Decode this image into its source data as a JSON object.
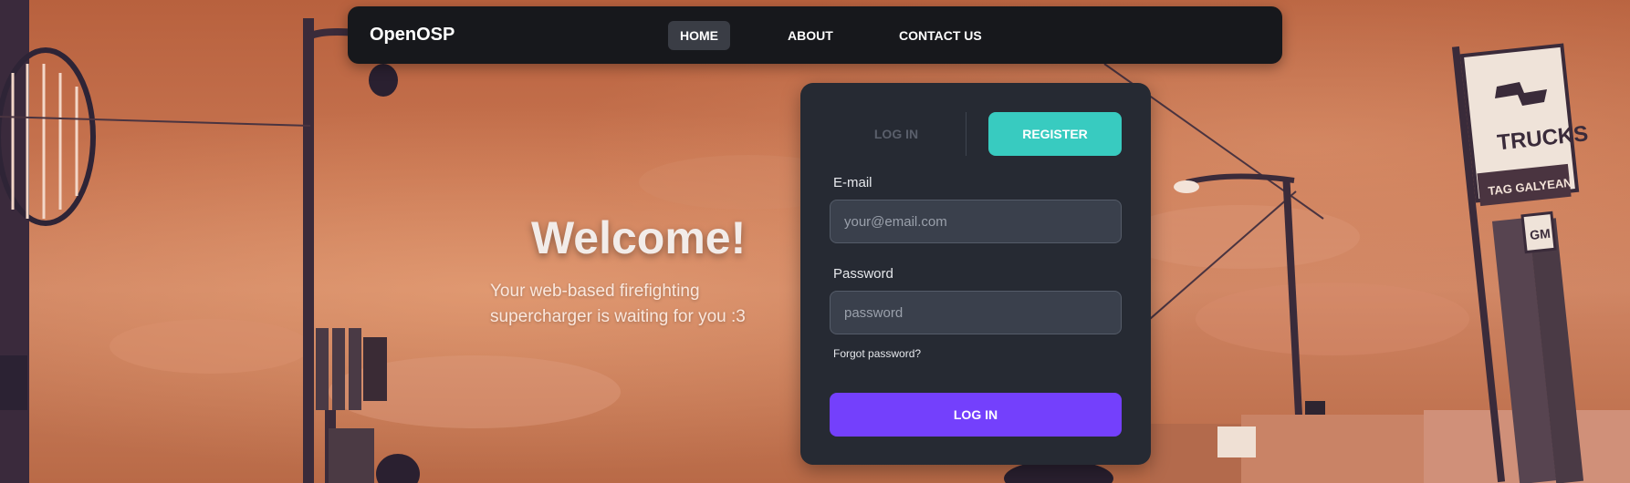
{
  "navbar": {
    "brand": "OpenOSP",
    "links": [
      {
        "label": "HOME",
        "active": true
      },
      {
        "label": "ABOUT",
        "active": false
      },
      {
        "label": "CONTACT US",
        "active": false
      }
    ]
  },
  "hero": {
    "title": "Welcome!",
    "subtitle": "Your web-based firefighting supercharger is waiting for you :3"
  },
  "auth": {
    "tabs": {
      "login_label": "LOG IN",
      "register_label": "REGISTER",
      "active": "register"
    },
    "email": {
      "label": "E-mail",
      "placeholder": "your@email.com",
      "value": ""
    },
    "password": {
      "label": "Password",
      "placeholder": "password",
      "value": ""
    },
    "forgot_label": "Forgot password?",
    "submit_label": "LOG IN"
  },
  "background": {
    "signs": {
      "trucks": "TRUCKS",
      "dealer": "TAG GALYEAN",
      "gm": "GM"
    }
  },
  "colors": {
    "navbar_bg": "#17181c",
    "card_bg": "#262a33",
    "register_accent": "#38cbc0",
    "submit_accent": "#7440fc",
    "input_bg": "#3a404c",
    "scene_tint": "#c77450"
  },
  "icons": [
    "street-lamp-icon",
    "traffic-light-icon",
    "chevrolet-sign-icon"
  ]
}
